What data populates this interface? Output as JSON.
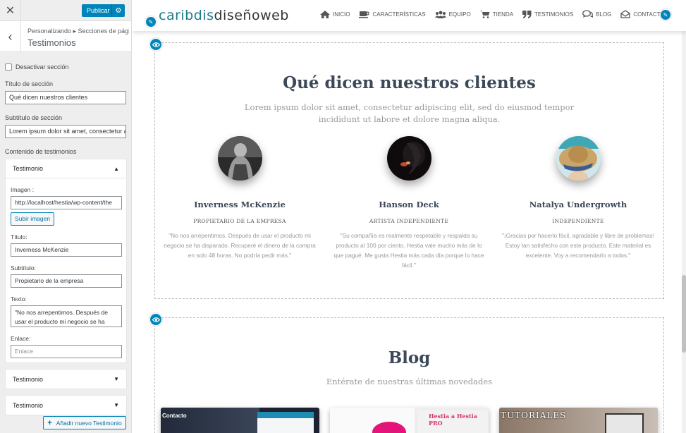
{
  "panel": {
    "close_icon": "close-icon",
    "publish_label": "Publicar",
    "breadcrumb": "Personalizando ▸ Secciones de pági...",
    "breadcrumb_parts": [
      "Personalizando",
      "Secciones de pági"
    ],
    "title": "Testimonios",
    "disable_label": "Desactivar sección",
    "section_title_label": "Título de sección",
    "section_title_value": "Qué dicen nuestros clientes",
    "section_subtitle_label": "Subtítulo de sección",
    "section_subtitle_value": "Lorem ipsum dolor sit amet, consectetur a",
    "content_label": "Contenido de testimonios",
    "item": {
      "header": "Testimonio",
      "image_label": "Imagen :",
      "image_value": "http://localhost/hestia/wp-content/the",
      "upload_label": "Subir imagen",
      "title_label": "Título:",
      "title_value": "Inverness McKenzie",
      "subtitle_label": "Subtítulo:",
      "subtitle_value": "Propietario de la empresa",
      "text_label": "Texto:",
      "text_value": "\"No nos arrepentimos. Después de usar el producto mi negocio se ha",
      "link_label": "Enlace:",
      "link_placeholder": "Enlace"
    },
    "collapsed_items": [
      "Testimonio",
      "Testimonio"
    ],
    "add_label": "Añadir nuevo Testimonio"
  },
  "site": {
    "logo_a": "caribdis",
    "logo_b": "diseñoweb",
    "menu": [
      {
        "label": "INICIO",
        "icon": "home-icon"
      },
      {
        "label": "CARACTERÍSTICAS",
        "icon": "coffee-icon"
      },
      {
        "label": "EQUIPO",
        "icon": "users-icon"
      },
      {
        "label": "TIENDA",
        "icon": "cart-icon"
      },
      {
        "label": "TESTIMONIOS",
        "icon": "quote-icon"
      },
      {
        "label": "BLOG",
        "icon": "comments-icon"
      },
      {
        "label": "CONTACTO",
        "icon": "envelope-icon"
      }
    ]
  },
  "testimonials": {
    "title": "Qué dicen nuestros clientes",
    "subtitle_line1": "Lorem ipsum dolor sit amet, consectetur adipiscing elit, sed do eiusmod tempor",
    "subtitle_line2": "incididunt ut labore et dolore magna aliqua.",
    "items": [
      {
        "name": "Inverness McKenzie",
        "role": "PROPIETARIO DE LA EMPRESA",
        "text": "\"No nos arrepentimos. Después de usar el producto mi negocio se ha disparado. Recuperé el dinero de la compra en solo 48 horas. No podría pedir más.\""
      },
      {
        "name": "Hanson Deck",
        "role": "ARTISTA INDEPENDIENTE",
        "text": "\"Su compañía es realmente respetable y respalda su producto al 100 por ciento. Hestia vale mucho más de lo que pagué. Me gusta Hestia más cada día porque lo hace fácil.\""
      },
      {
        "name": "Natalya Undergrowth",
        "role": "INDEPENDIENTE",
        "text": "\"¡Gracias por hacerlo fácil, agradable y libre de problemas! Estoy tan satisfecho con este producto. Este material es excelente. Voy a recomendarlo a todos.\""
      }
    ]
  },
  "blog": {
    "title": "Blog",
    "subtitle": "Entérate de nuestras últimas novedades",
    "cards": [
      {
        "caption": "Contacto"
      },
      {
        "caption": "Hestia a Hestia PRO"
      },
      {
        "caption": "TUTORIALES"
      }
    ]
  },
  "colors": {
    "accent": "#0085ba",
    "heading": "#3c4858",
    "logo": "#1c7a8c"
  }
}
